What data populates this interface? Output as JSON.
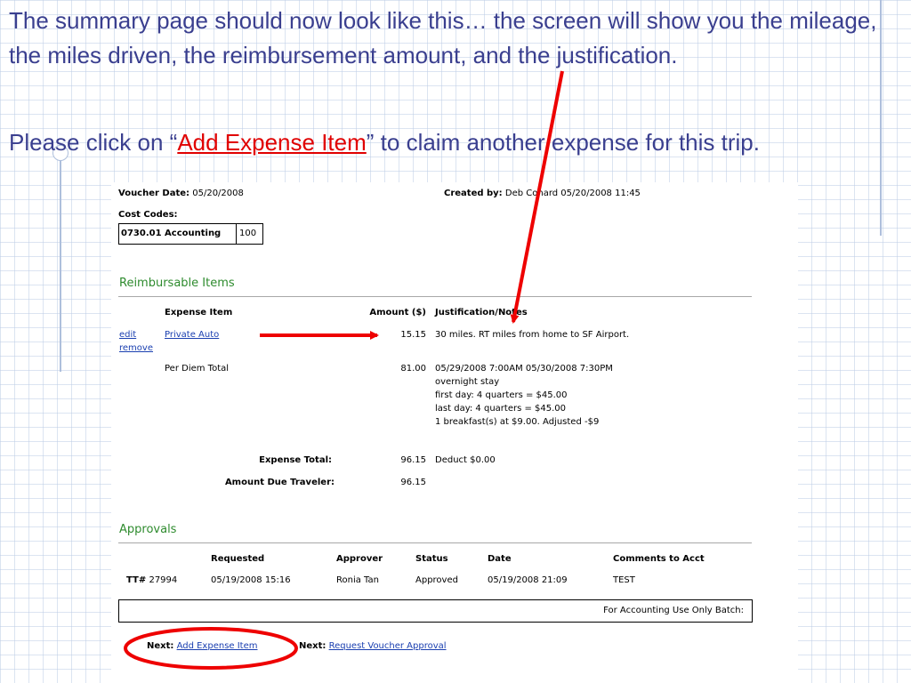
{
  "slide": {
    "para1": "The summary page should now look like this… the screen will show you the mileage, the miles driven, the reimbursement amount, and the justification.",
    "para2_before": "Please click on “",
    "para2_link": "Add Expense Item",
    "para2_after": "” to claim another expense for this trip."
  },
  "voucher": {
    "date_label": "Voucher Date:",
    "date_value": "05/20/2008",
    "created_label": "Created by:",
    "created_value": "Deb Conard 05/20/2008 11:45",
    "cost_codes_label": "Cost Codes:",
    "cost_code_name": "0730.01 Accounting",
    "cost_code_pct": "100"
  },
  "reimbursable": {
    "title": "Reimbursable Items",
    "headers": {
      "item": "Expense Item",
      "amount": "Amount ($)",
      "notes": "Justification/Notes"
    },
    "edit_label": "edit",
    "remove_label": "remove",
    "row1": {
      "item": "Private Auto",
      "amount": "15.15",
      "notes": "30 miles. RT miles from home to SF Airport."
    },
    "row2": {
      "item": "Per Diem Total",
      "amount": "81.00",
      "notes": [
        "05/29/2008  7:00AM    05/30/2008  7:30PM",
        "overnight stay",
        "first day: 4 quarters = $45.00",
        "last day: 4 quarters = $45.00",
        "1 breakfast(s) at $9.00. Adjusted -$9"
      ]
    },
    "total_label": "Expense Total:",
    "total_value": "96.15",
    "total_note": "Deduct $0.00",
    "due_label": "Amount Due Traveler:",
    "due_value": "96.15"
  },
  "approvals": {
    "title": "Approvals",
    "headers": {
      "requested": "Requested",
      "approver": "Approver",
      "status": "Status",
      "date": "Date",
      "comments": "Comments to Acct"
    },
    "row": {
      "tt": "TT#",
      "tt_num": "27994",
      "requested": "05/19/2008 15:16",
      "approver": "Ronia Tan",
      "status": "Approved",
      "date": "05/19/2008 21:09",
      "comments": "TEST"
    }
  },
  "batch_label": "For Accounting Use Only Batch:",
  "next": {
    "label1": "Next:",
    "link1": "Add Expense Item",
    "label2": "Next:",
    "link2": "Request Voucher Approval"
  },
  "colors": {
    "slide_text": "#3a3f8f",
    "link_red": "#e00000",
    "section_green": "#2e8b2e",
    "annotation_red": "#ee0000",
    "link_blue": "#1a3fb0"
  }
}
